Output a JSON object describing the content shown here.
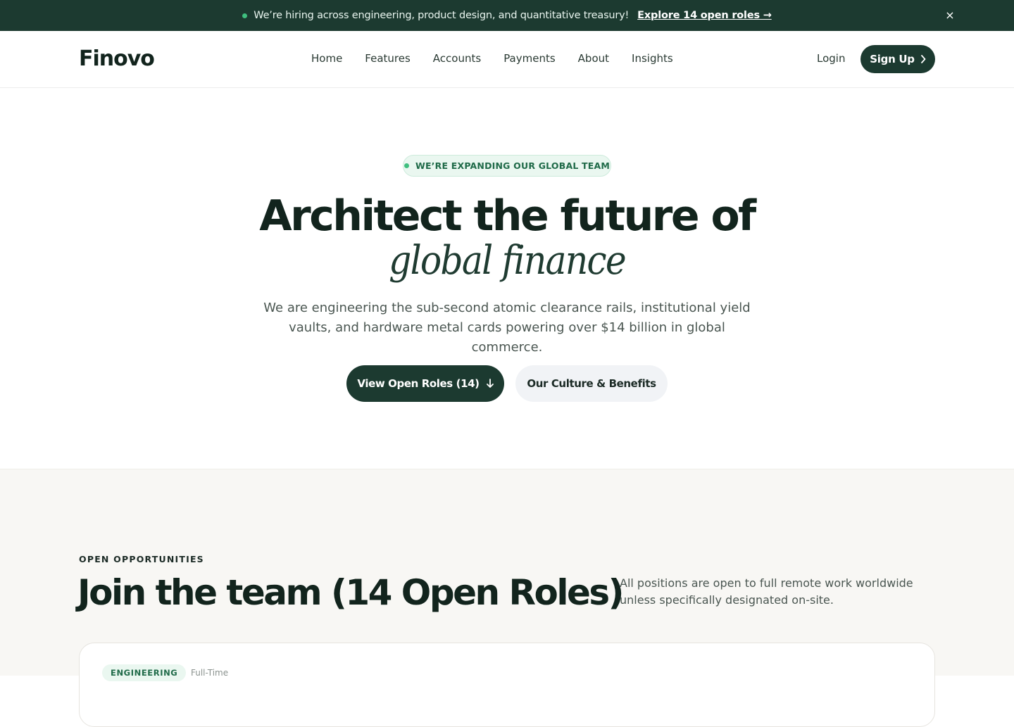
{
  "announcement": {
    "message": "We’re hiring across engineering, product design, and quantitative treasury!",
    "link": "Explore 14 open roles →",
    "close": "×"
  },
  "header": {
    "logo": "Finovo",
    "nav": [
      "Home",
      "Features",
      "Accounts",
      "Payments",
      "About",
      "Insights"
    ],
    "login": "Login",
    "signup": "Sign Up"
  },
  "hero": {
    "pill": "WE’RE EXPANDING OUR GLOBAL TEAM",
    "title_line1": "Architect the future of",
    "title_line2": "global finance",
    "subtitle": "We are engineering the sub-second atomic clearance rails, institutional yield vaults, and hardware metal cards powering over $14 billion in global commerce.",
    "primary_button": "View Open Roles (14)",
    "secondary_button": "Our Culture & Benefits"
  },
  "opportunities": {
    "eyebrow": "OPEN OPPORTUNITIES",
    "title": "Join the team (14 Open Roles)",
    "note": "All positions are open to full remote work worldwide unless specifically designated on-site.",
    "first_card": {
      "tag": "ENGINEERING",
      "type": "Full-Time"
    }
  },
  "colors": {
    "brand_dark": "#1c3a30",
    "accent_green": "#3fbf7f"
  },
  "icons": [
    "close-icon",
    "chevron-right-icon",
    "arrow-down-icon",
    "status-dot-icon"
  ]
}
